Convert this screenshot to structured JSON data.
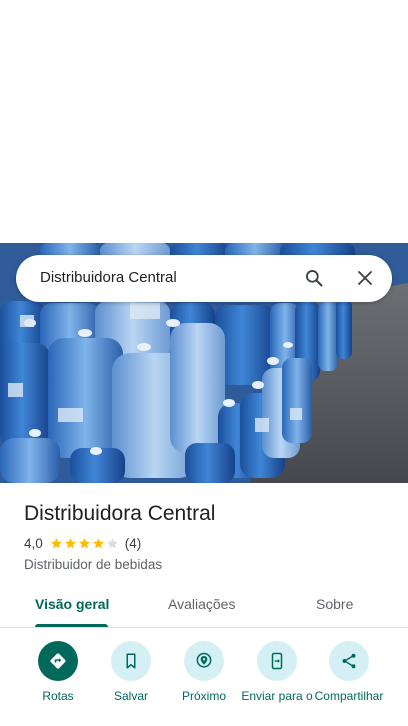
{
  "search": {
    "query": "Distribuidora Central",
    "search_icon": "search-icon",
    "close_icon": "close-icon"
  },
  "place": {
    "name": "Distribuidora Central",
    "rating": "4,0",
    "rating_value": 4.0,
    "review_count": "(4)",
    "category": "Distribuidor de bebidas",
    "photo": "water-jugs-photo"
  },
  "tabs": [
    {
      "label": "Visão geral",
      "active": true
    },
    {
      "label": "Avaliações",
      "active": false
    },
    {
      "label": "Sobre",
      "active": false
    }
  ],
  "actions": [
    {
      "label": "Rotas",
      "icon": "directions-icon"
    },
    {
      "label": "Salvar",
      "icon": "bookmark-icon"
    },
    {
      "label": "Próximo",
      "icon": "nearby-icon"
    },
    {
      "label": "Enviar para o",
      "icon": "send-to-phone-icon"
    },
    {
      "label": "Compartilhar",
      "icon": "share-icon"
    }
  ],
  "colors": {
    "accent": "#00695c",
    "action_bg": "#d4f0f5",
    "star": "#fbbc04",
    "star_empty": "#dadce0"
  }
}
